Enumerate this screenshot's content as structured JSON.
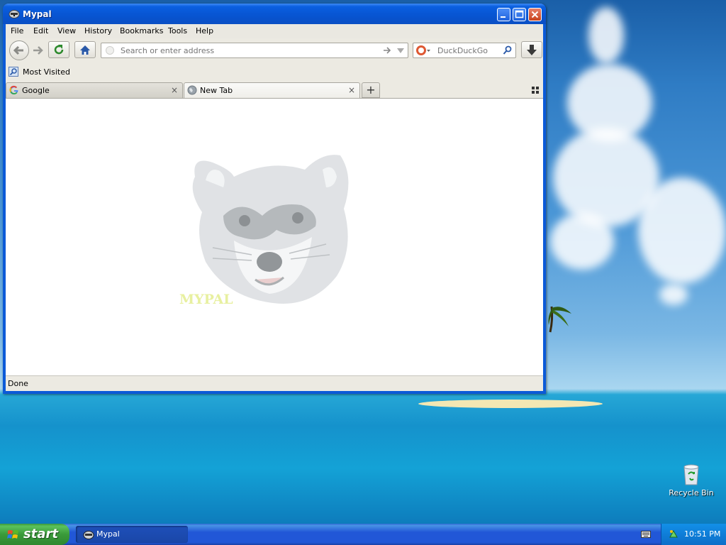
{
  "window": {
    "title": "Mypal"
  },
  "menu": {
    "items": [
      {
        "label": "File"
      },
      {
        "label": "Edit"
      },
      {
        "label": "View"
      },
      {
        "label": "History"
      },
      {
        "label": "Bookmarks"
      },
      {
        "label": "Tools"
      },
      {
        "label": "Help"
      }
    ]
  },
  "navbar": {
    "address_placeholder": "Search or enter address",
    "search_engine": "DuckDuckGo"
  },
  "bookmarks": {
    "most_visited": "Most Visited"
  },
  "tabs": [
    {
      "label": "Google",
      "active": false,
      "close": "×"
    },
    {
      "label": "New Tab",
      "active": true,
      "close": "×"
    }
  ],
  "new_tab_symbol": "+",
  "content": {
    "logo_text": "MYPAL"
  },
  "statusbar": {
    "text": "Done"
  },
  "desktop": {
    "recycle_bin": "Recycle Bin"
  },
  "taskbar": {
    "start_label": "start",
    "task_label": "Mypal",
    "clock": "10:51 PM"
  }
}
